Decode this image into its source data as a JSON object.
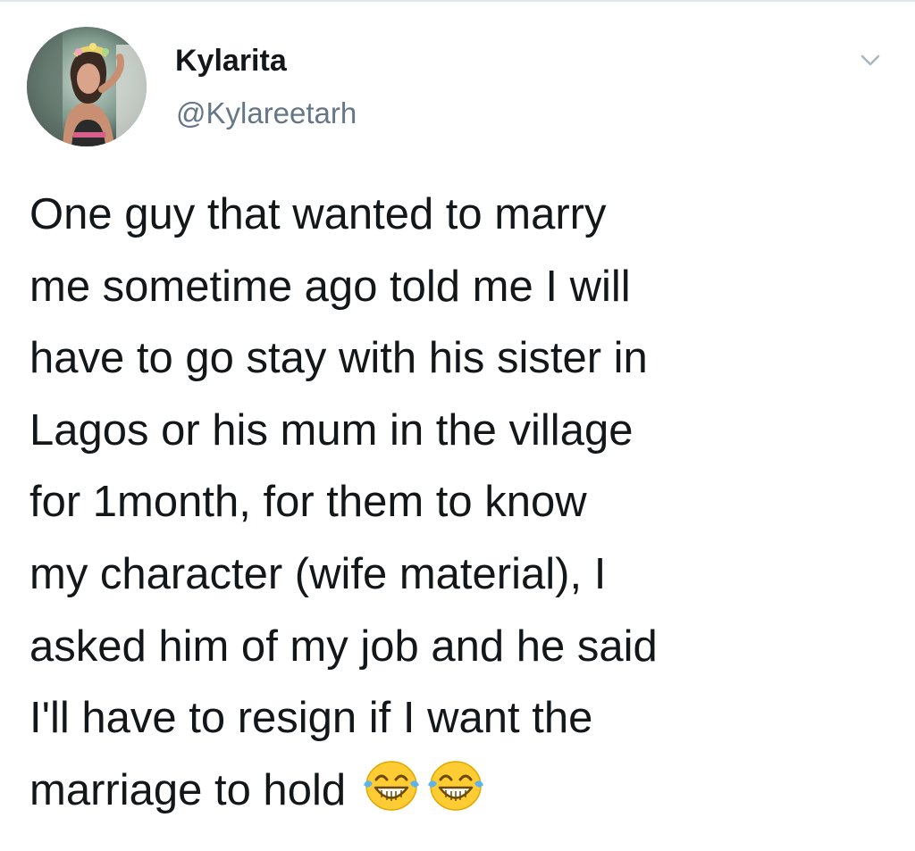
{
  "tweet": {
    "author": {
      "display_name": "Kylarita",
      "handle": "@Kylareetarh",
      "avatar_icon": "profile-photo"
    },
    "menu_icon": "chevron-down-icon",
    "text_lines": [
      "One guy that wanted to marry",
      "me sometime ago told me I will",
      "have to go stay with his sister in",
      "Lagos or his mum in the village",
      "for 1month, for them to know",
      "my character (wife material), I",
      "asked him of my job and he said",
      "I'll have to resign if I want the",
      "marriage to hold"
    ],
    "emojis": [
      "face-with-tears-of-joy-icon",
      "face-with-tears-of-joy-icon"
    ]
  },
  "colors": {
    "text": "#14171a",
    "secondary_text": "#657786",
    "border": "#e1e8ed",
    "emoji_face": "#ffcc33"
  }
}
